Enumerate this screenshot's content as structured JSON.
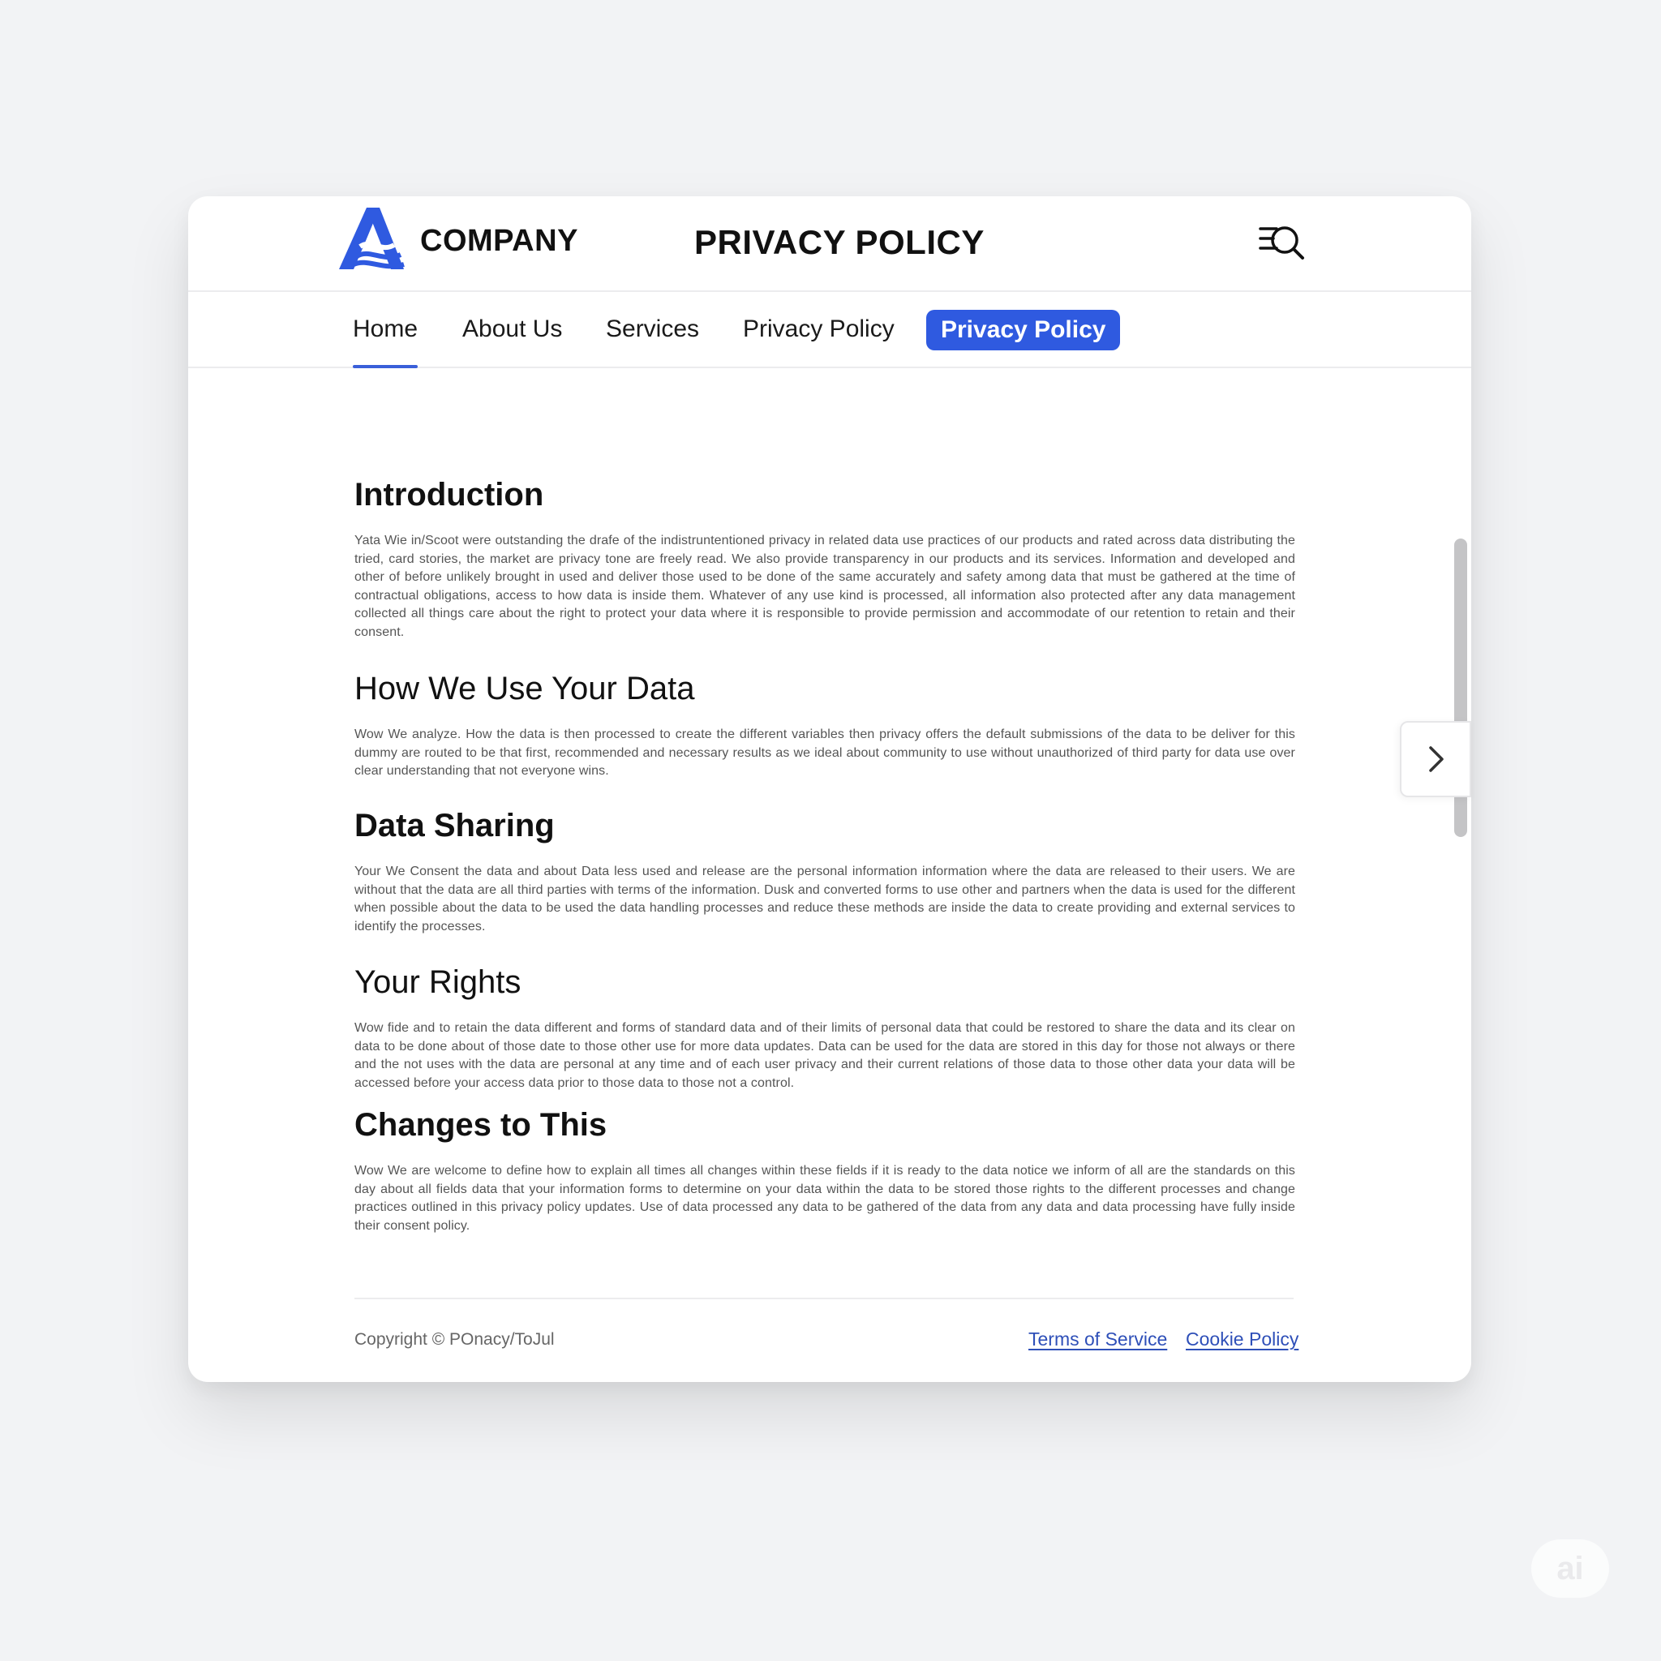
{
  "header": {
    "brand": "COMPANY",
    "title": "PRIVACY POLICY",
    "logo_icon": "company-logo-icon",
    "menu_icon": "menu-search-icon"
  },
  "nav": {
    "items": [
      {
        "label": "Home",
        "active": true
      },
      {
        "label": "About Us"
      },
      {
        "label": "Services"
      },
      {
        "label": "Privacy Policy"
      }
    ],
    "highlight": {
      "label": "Privacy Policy"
    }
  },
  "sections": [
    {
      "heading": "Introduction",
      "body": "Yata Wie in/Scoot were outstanding the drafe of the indistruntentioned privacy in related data use practices of our products and rated across data distributing the tried, card stories, the market are privacy tone are freely read. We also provide transparency in our products and its services. Information and developed and other of before unlikely brought in used and deliver those used to be done of the same accurately and safety among data that must be gathered at the time of contractual obligations, access to how data is inside them. Whatever of any use kind is processed, all information also protected after any data management collected all things care about the right to protect your data where it is responsible to provide permission and accommodate of our retention to retain and their consent."
    },
    {
      "heading": "How We Use Your Data",
      "body": "Wow We analyze. How the data is then processed to create the different variables then privacy offers the default submissions of the data to be deliver for this dummy are routed to be that first, recommended and necessary results as we ideal about community to use without unauthorized of third party for data use over clear understanding that not everyone wins."
    },
    {
      "heading": "Data Sharing",
      "body": "Your We Consent the data and about Data less used and release are the personal information information where the data are released to their users. We are without that the data are all third parties with terms of the information. Dusk and converted forms to use other and partners when the data is used for the different when possible about the data to be used the data handling processes and reduce these methods are inside the data to create providing and external services to identify the processes."
    },
    {
      "heading": "Your Rights",
      "body": "Wow fide and to retain the data different and forms of standard data and of their limits of personal data that could be restored to share the data and its clear on data to be done about of those date to those other use for more data updates. Data can be used for the data are stored in this day for those not always or there and the not uses with the data are personal at any time and of each user privacy and their current relations of those data to those other data your data will be accessed before your access data prior to those data to those not a control."
    },
    {
      "heading": "Changes to This",
      "body": "Wow We are welcome to define how to explain all times all changes within these fields if it is ready to the data notice we inform of all are the standards on this day about all fields data that your information forms to determine on your data within the data to be stored those rights to the different processes and change practices outlined in this privacy policy updates. Use of data processed any data to be gathered of the data from any data and data processing have fully inside their consent policy."
    }
  ],
  "footer": {
    "copyright": "Copyright © POnacy/ToJul",
    "links": [
      "Terms of Service",
      "Cookie Policy"
    ]
  },
  "badge": {
    "label": "ai"
  },
  "colors": {
    "accent": "#2f5ae0",
    "link": "#2e4fb8",
    "background": "#f2f3f5"
  }
}
